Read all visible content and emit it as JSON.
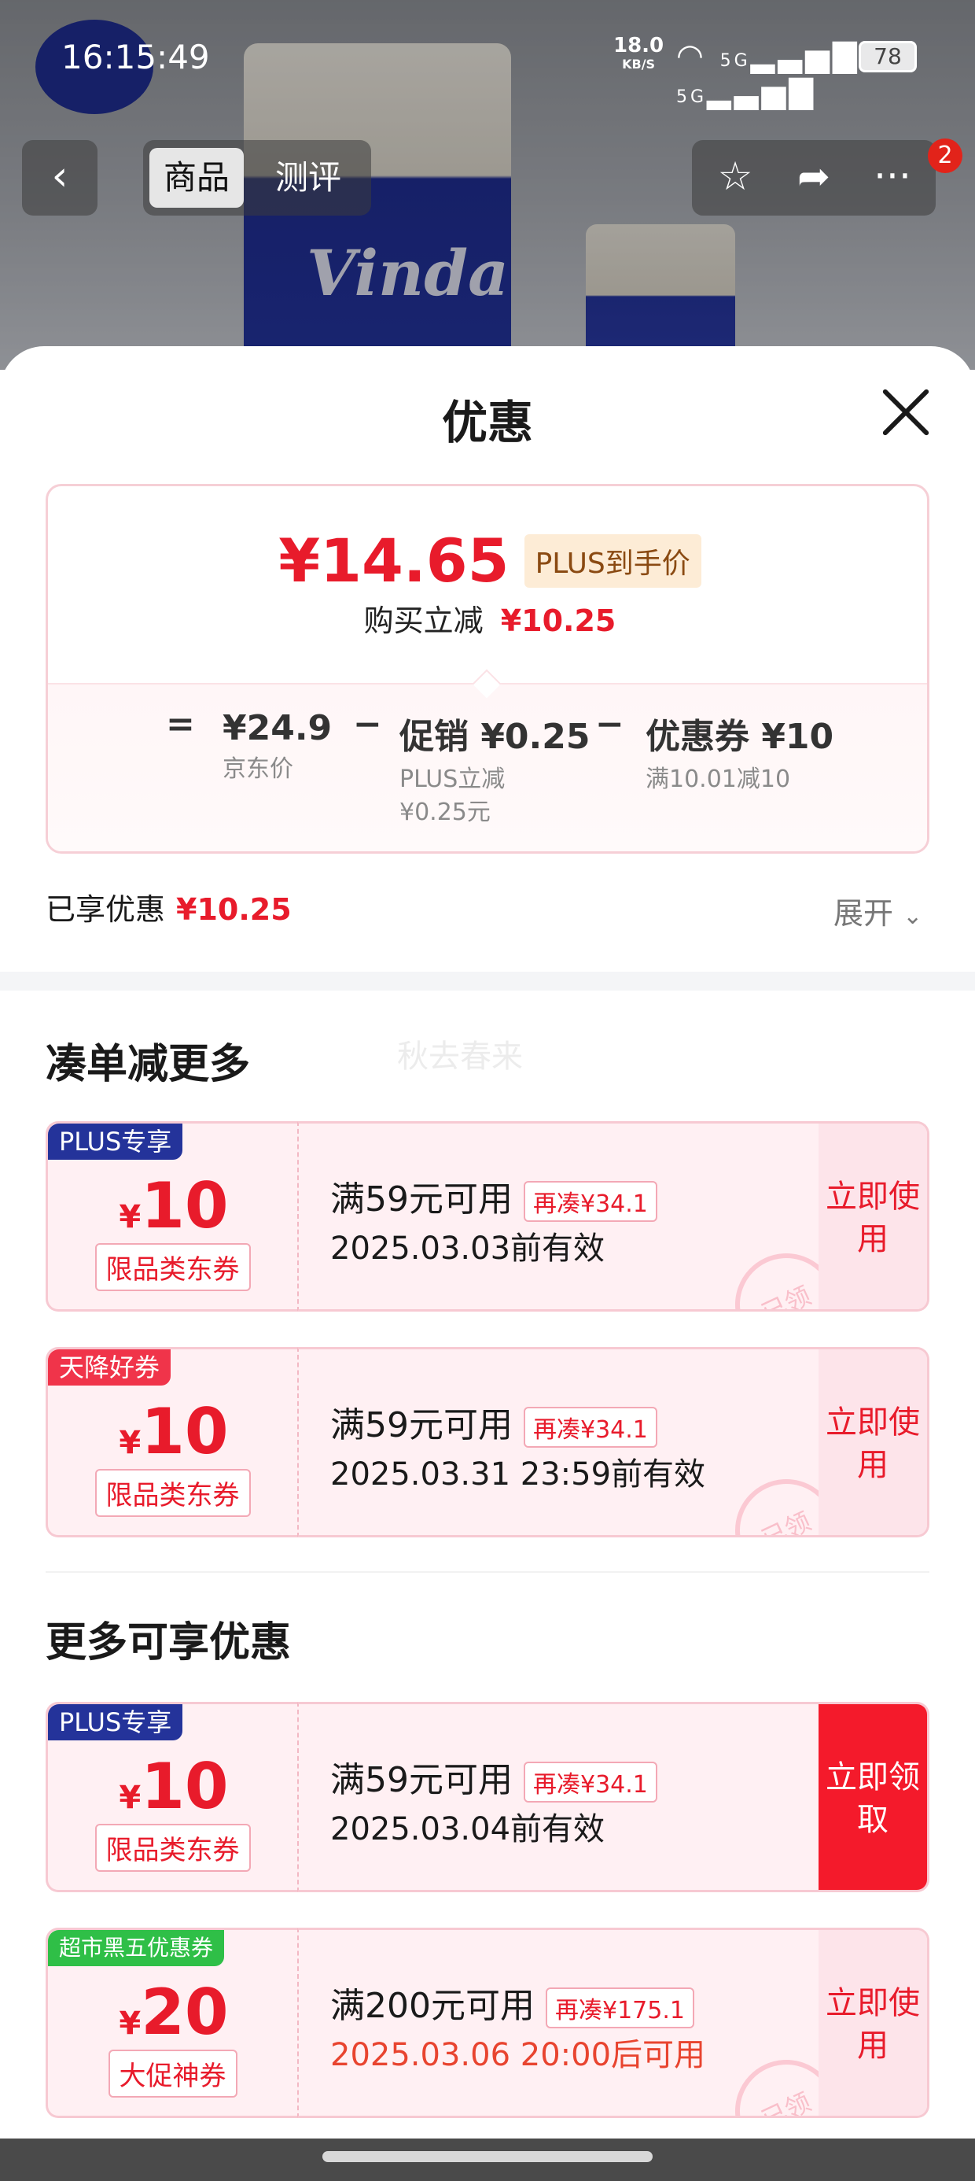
{
  "status_bar": {
    "time": "16:15:49",
    "net_speed": "18.0",
    "net_unit": "KB/S",
    "network": "5G",
    "battery": "78"
  },
  "nav": {
    "back_icon": "chevron-left-icon",
    "tabs": [
      "商品",
      "测评"
    ],
    "badge": "2"
  },
  "sheet": {
    "title": "优惠",
    "close_icon": "close-icon"
  },
  "price_card": {
    "final_price": "¥14.65",
    "price_tag": "PLUS到手价",
    "saving_label": "购买立减",
    "saving_value": "¥10.25",
    "breakdown": [
      {
        "op": "=",
        "value": "¥24.9",
        "sub": "京东价"
      },
      {
        "op": "−",
        "value": "促销 ¥0.25",
        "sub": "PLUS立减 ¥0.25元"
      },
      {
        "op": "−",
        "value": "优惠券 ¥10",
        "sub": "满10.01减10"
      }
    ]
  },
  "enjoyed": {
    "label": "已享优惠",
    "value": "¥10.25",
    "expand": "展开"
  },
  "section1": {
    "title": "凑单减更多",
    "ghost": "秋去春来"
  },
  "section2": {
    "title": "更多可享优惠"
  },
  "coupons": [
    {
      "tag": "PLUS专享",
      "currency": "¥",
      "amount": "10",
      "type": "限品类东券",
      "condition": "满59元可用",
      "add": "再凑¥34.1",
      "valid": "2025.03.03前有效",
      "action": "立即使用",
      "stamp": "已领"
    },
    {
      "tag": "天降好券",
      "currency": "¥",
      "amount": "10",
      "type": "限品类东券",
      "condition": "满59元可用",
      "add": "再凑¥34.1",
      "valid": "2025.03.31 23:59前有效",
      "action": "立即使用",
      "stamp": "已领"
    },
    {
      "tag": "PLUS专享",
      "currency": "¥",
      "amount": "10",
      "type": "限品类东券",
      "condition": "满59元可用",
      "add": "再凑¥34.1",
      "valid": "2025.03.04前有效",
      "action": "立即领取",
      "stamp": ""
    },
    {
      "tag": "超市黑五优惠券",
      "currency": "¥",
      "amount": "20",
      "type": "大促神券",
      "condition": "满200元可用",
      "add": "再凑¥175.1",
      "valid": "2025.03.06 20:00后可用",
      "action": "立即使用",
      "stamp": "已领"
    }
  ],
  "colors": {
    "accent_red": "#e81b2b",
    "plus_blue": "#24339a",
    "tag_red": "#f0344a",
    "tag_green": "#2fbf47"
  }
}
